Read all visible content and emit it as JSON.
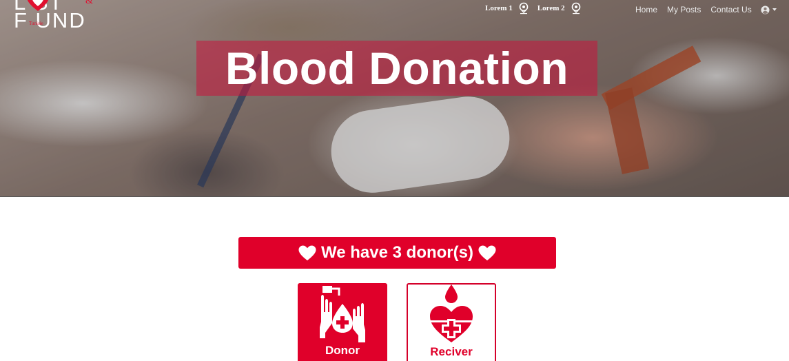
{
  "logo": {
    "line1": "L  ST",
    "line2": "F UND",
    "amp": "&",
    "small": "Tunisie"
  },
  "sponsors": [
    {
      "label": "Lorem 1",
      "icon": "pin-logo-icon"
    },
    {
      "label": "Lorem 2",
      "icon": "pin-logo-icon"
    }
  ],
  "nav": {
    "home": "Home",
    "my_posts": "My Posts",
    "contact_us": "Contact Us",
    "user_icon": "user-circle-icon"
  },
  "hero": {
    "title": "Blood Donation"
  },
  "banner": {
    "text": "We have 3 donor(s)",
    "icon": "heart-icon"
  },
  "cards": {
    "donor": {
      "label": "Donor",
      "icon": "donor-hands-icon"
    },
    "receiver": {
      "label": "Reciver",
      "icon": "heart-drop-icon"
    }
  },
  "colors": {
    "accent": "#e0002a",
    "hero_title_bg": "#c8143c",
    "white": "#ffffff"
  }
}
